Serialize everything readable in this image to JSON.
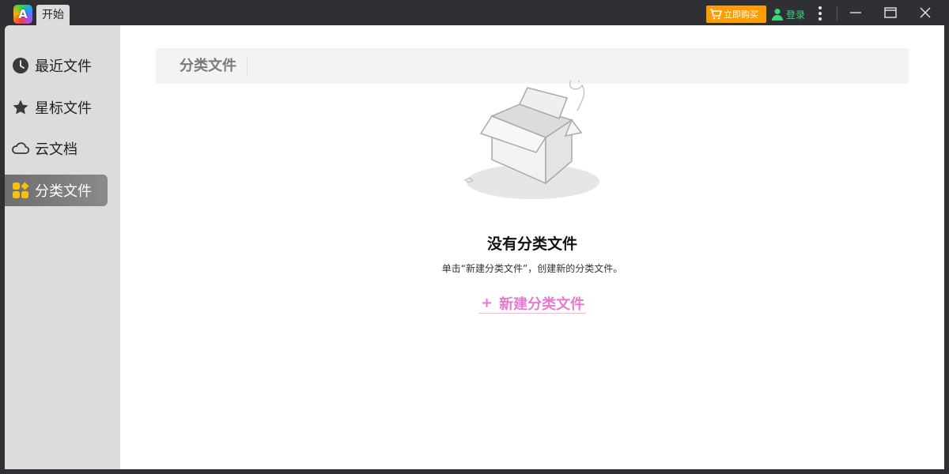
{
  "titlebar": {
    "logo_letter": "A",
    "tab_label": "开始",
    "buy_label": "立即购买",
    "login_label": "登录"
  },
  "sidebar": {
    "items": [
      {
        "label": "最近文件",
        "icon": "clock-icon"
      },
      {
        "label": "星标文件",
        "icon": "star-icon"
      },
      {
        "label": "云文档",
        "icon": "cloud-icon"
      },
      {
        "label": "分类文件",
        "icon": "category-icon",
        "active": true
      }
    ]
  },
  "main": {
    "section_title": "分类文件",
    "empty_title": "没有分类文件",
    "empty_desc": "单击“新建分类文件”，创建新的分类文件。",
    "new_plus": "+",
    "new_label": "新建分类文件"
  },
  "colors": {
    "buy_orange": "#ff9d00",
    "login_green": "#3ad47a",
    "link_pink": "#e57ad0",
    "category_yellow": "#f4c20d"
  }
}
